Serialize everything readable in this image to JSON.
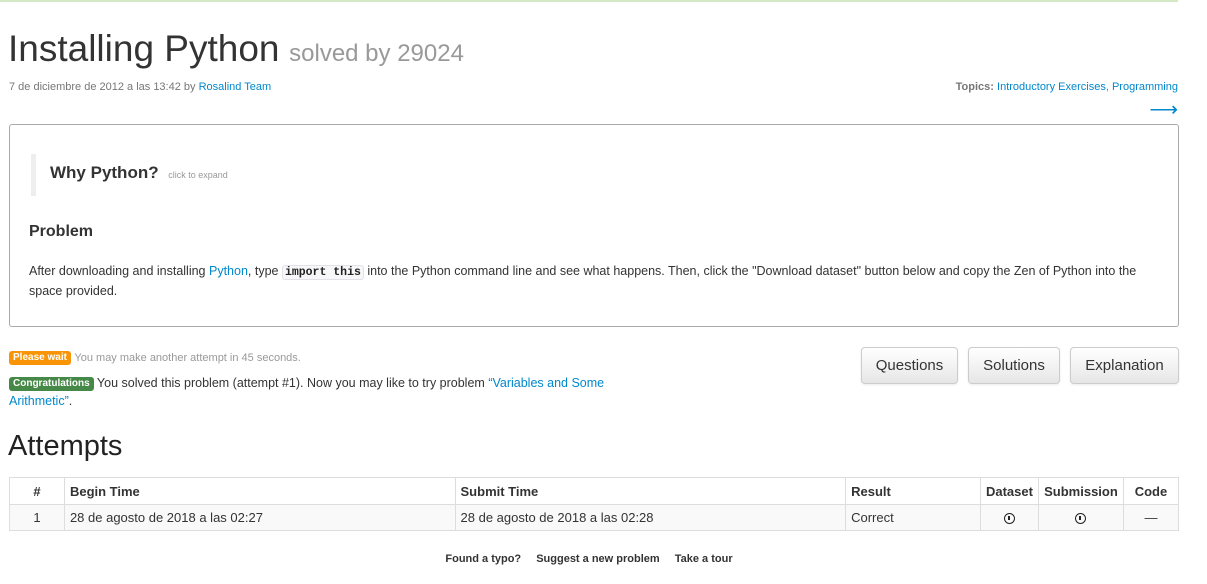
{
  "problem": {
    "title": "Installing Python",
    "solved_by": "solved by 29024",
    "date": "7 de diciembre de 2012 a las 13:42",
    "by_label": "by",
    "author": "Rosalind Team",
    "topics_label": "Topics:",
    "topics": [
      "Introductory Exercises",
      "Programming"
    ],
    "next_arrow": "⟶"
  },
  "why": {
    "title": "Why Python?",
    "hint": "click to expand"
  },
  "statement": {
    "heading": "Problem",
    "text_1": "After downloading and installing ",
    "link": "Python",
    "text_2": ", type ",
    "code": "import this",
    "text_3": " into the Python command line and see what happens. Then, click the \"Download dataset\" button below and copy the Zen of Python into the space provided."
  },
  "status": {
    "wait_badge": "Please wait",
    "wait_text": "You may make another attempt in 45 seconds.",
    "congrats_badge": "Congratulations",
    "congrats_text": "You solved this problem (attempt #1). Now you may like to try problem ",
    "next_problem": "“Variables and Some Arithmetic”",
    "period": "."
  },
  "buttons": {
    "questions": "Questions",
    "solutions": "Solutions",
    "explanation": "Explanation"
  },
  "attempts": {
    "heading": "Attempts",
    "columns": [
      "#",
      "Begin Time",
      "Submit Time",
      "Result",
      "Dataset",
      "Submission",
      "Code"
    ],
    "rows": [
      {
        "num": "1",
        "begin": "28 de agosto de 2018 a las 02:27",
        "submit": "28 de agosto de 2018 a las 02:28",
        "result": "Correct",
        "dataset_icon": "download-icon",
        "submission_icon": "download-icon",
        "code": "—"
      }
    ]
  },
  "footer": {
    "typo": "Found a typo?",
    "suggest": "Suggest a new problem",
    "tour": "Take a tour"
  }
}
